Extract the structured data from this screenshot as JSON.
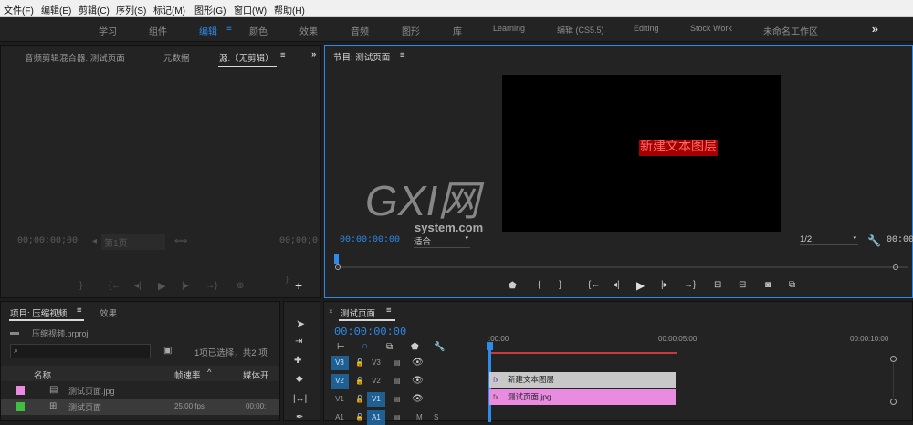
{
  "menu": [
    "文件(F)",
    "编辑(E)",
    "剪辑(C)",
    "序列(S)",
    "标记(M)",
    "图形(G)",
    "窗口(W)",
    "帮助(H)"
  ],
  "workspaces": [
    "学习",
    "组件",
    "编辑",
    "颜色",
    "效果",
    "音频",
    "图形",
    "库",
    "Learning",
    "编辑 (CS5.5)",
    "Editing",
    "Stock Work",
    "未命名工作区"
  ],
  "ws_more": "»",
  "source": {
    "tab1": "音频剪辑混合器: 测试页面",
    "tab2": "元数据",
    "tab3": "源:（无剪辑）",
    "tc_left": "00;00;00;00",
    "page": "第1页",
    "tc_right": "00;00;0",
    "more": "»"
  },
  "program": {
    "title": "节目: 测试页面",
    "tc": "00:00:00:00",
    "fit": "适合",
    "res": "1/2",
    "tc_right": "00:00",
    "overlay_text": "新建文本图层",
    "watermark_big": "GXI网",
    "watermark_small": "system.com"
  },
  "project": {
    "tab": "项目: 压缩视频",
    "tab2": "效果",
    "file": "压缩视频.prproj",
    "selection": "1项已选择，共2 项",
    "col_name": "名称",
    "col_fps": "帧速率",
    "col_media": "媒体开",
    "items": [
      {
        "name": "测试页面.jpg",
        "fps": "",
        "media": "",
        "color": "#e98be0"
      },
      {
        "name": "测试页面",
        "fps": "25.00 fps",
        "media": "00:00:",
        "color": "#3fbf3f"
      }
    ]
  },
  "timeline": {
    "tab": "测试页面",
    "tc": "00:00:00:00",
    "ruler": [
      ":00:00",
      "00:00:05:00",
      "00:00:10:00"
    ],
    "tracks": [
      {
        "a": "V3",
        "b": "V3"
      },
      {
        "a": "V2",
        "b": "V2"
      },
      {
        "a": "V1",
        "b": "V1"
      },
      {
        "a": "A1",
        "b": "A1"
      }
    ],
    "clips": [
      {
        "name": "新建文本图层",
        "color": "#c8c8c8"
      },
      {
        "name": "测试页面.jpg",
        "color": "#e98be0"
      }
    ],
    "track_buttons": [
      "M",
      "S"
    ]
  }
}
